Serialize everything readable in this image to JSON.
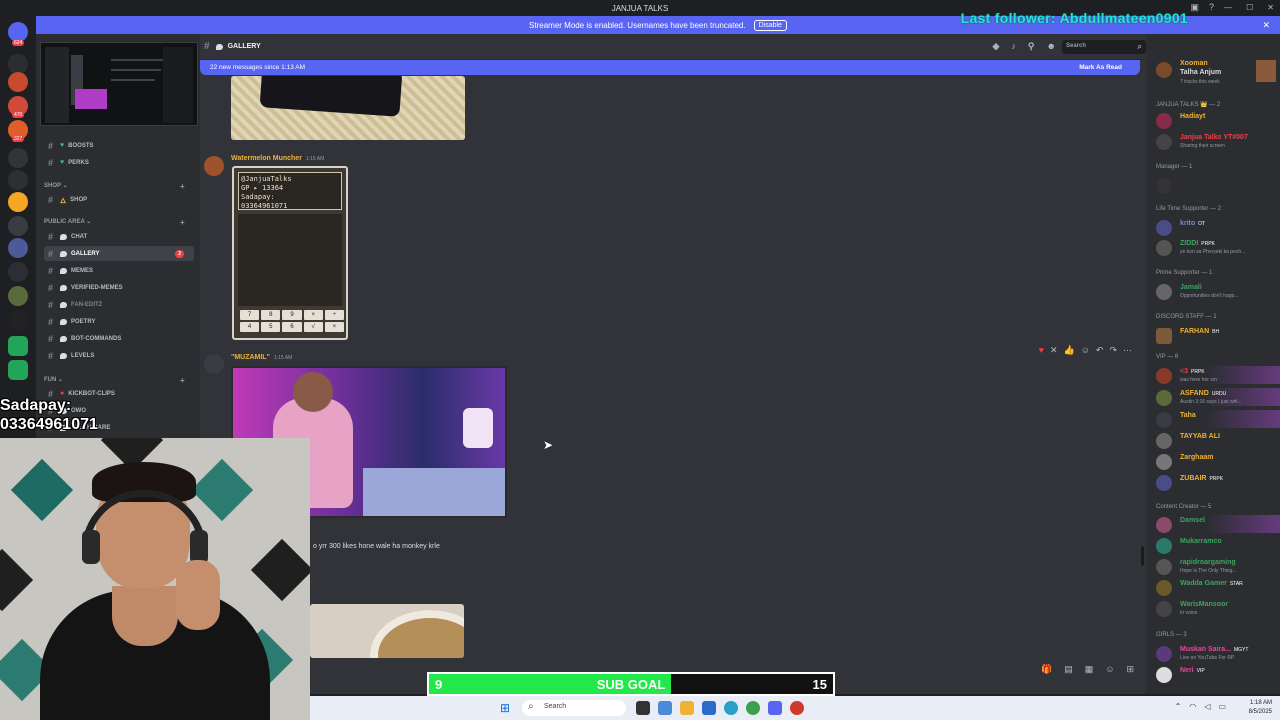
{
  "window": {
    "title": "JANJUA TALKS"
  },
  "overlays": {
    "last_follower": "Last follower: Abdullmateen0901",
    "sadapay_line1": "Sadapay:",
    "sadapay_line2": "03364961071"
  },
  "banner": {
    "text": "Streamer Mode is enabled. Usernames have been truncated.",
    "disable_label": "Disable"
  },
  "rail": {
    "badges": [
      "624",
      "470",
      "327"
    ]
  },
  "sidebar": {
    "categories": {
      "shop": "SHOP",
      "public": "PUBLIC AREA",
      "fun": "FUN"
    },
    "channels": [
      "BOOSTS",
      "PERKS",
      "SHOP",
      "CHAT",
      "GALLERY",
      "MEMES",
      "VERIFIED-MEMES",
      "FAN-EDITZ",
      "POETRY",
      "BOT-COMMANDS",
      "LEVELS",
      "KICKBOT-CLIPS",
      "OWO",
      "TRUTH-DARE"
    ],
    "gallery_badge": "2"
  },
  "header": {
    "channel": "GALLERY",
    "search_placeholder": "Search"
  },
  "new_messages": {
    "text": "22 new messages since 1:13 AM",
    "mark_read": "Mark As Read"
  },
  "messages": [
    {
      "author": "Watermelon Muncher",
      "time": "1:15 AM",
      "color": "#f0b232"
    },
    {
      "author": "\"MUZAMIL\"",
      "time": "1:15 AM",
      "color": "#f0b232"
    }
  ],
  "calc_screen": {
    "line1": "@JanjuaTalks",
    "line2": "GP ▸ 13364",
    "line3": "Sadapay:",
    "line4": "03364961071"
  },
  "calc_keys": [
    "7",
    "8",
    "9",
    "×",
    "÷",
    "4",
    "5",
    "6",
    "√",
    "×"
  ],
  "reply": {
    "text": "o yrr 300 likes hone wale ha monkey krle"
  },
  "members": {
    "top": {
      "name": "Xooman",
      "name2": "Talha Anjum",
      "status": "7 tracks this week"
    },
    "groups": [
      {
        "label": "JANJUA TALKS 👑 — 2"
      },
      {
        "label": "Manager — 1"
      },
      {
        "label": "Life Time Supporter — 2"
      },
      {
        "label": "Prime Supporter — 1"
      },
      {
        "label": "DISCORD STAFF — 1"
      },
      {
        "label": "VIP — 6"
      },
      {
        "label": "Content Creator — 5"
      },
      {
        "label": "GIRLS — 3"
      }
    ],
    "list": [
      {
        "name": "Hadiayt",
        "status": "",
        "tag": "",
        "color": "#f0b232"
      },
      {
        "name": "Janjua Talks YT#007",
        "status": "Sharing their screen",
        "tag": "",
        "color": "#f23f43"
      },
      {
        "name": "krito",
        "status": "",
        "tag": "OT",
        "color": "#5865f2"
      },
      {
        "name": "ZIDDI",
        "status": "ye kon sa Pheryeki ka pech...",
        "tag": "PRPK",
        "color": "#3ba55d"
      },
      {
        "name": "Jamali",
        "status": "Opportunities don't happ...",
        "tag": "",
        "color": "#3ba55d"
      },
      {
        "name": "FARHAN",
        "status": "",
        "tag": "BH",
        "color": "#f0b232"
      },
      {
        "name": "<3",
        "status": "was here her sm",
        "tag": "PRPK",
        "color": "#f23f43"
      },
      {
        "name": "ASFAND",
        "status": "Austin 3:16 says I just whi...",
        "tag": "URDU",
        "color": "#f0b232"
      },
      {
        "name": "Taha",
        "status": "",
        "tag": "",
        "color": "#f0b232"
      },
      {
        "name": "TAYYAB ALI",
        "status": "",
        "tag": "",
        "color": "#f0b232"
      },
      {
        "name": "Zarghaam",
        "status": "",
        "tag": "",
        "color": "#f0b232"
      },
      {
        "name": "ZUBAIR",
        "status": "",
        "tag": "PRPK",
        "color": "#f0b232"
      },
      {
        "name": "Damsel",
        "status": "",
        "tag": "",
        "color": "#3ba55d"
      },
      {
        "name": "Mukarramco",
        "status": "",
        "tag": "",
        "color": "#3ba55d"
      },
      {
        "name": "rapidroargaming",
        "status": "Hope is The Only Thing...",
        "tag": "",
        "color": "#3ba55d"
      },
      {
        "name": "Wadda Gamer",
        "status": "",
        "tag": "STAR",
        "color": "#3ba55d"
      },
      {
        "name": "WarisMansoor",
        "status": "In voice",
        "tag": "",
        "color": "#3ba55d"
      },
      {
        "name": "Muskan Saira...",
        "status": "Live on YouTube For RP",
        "tag": "MGYT",
        "color": "#eb459e"
      },
      {
        "name": "Neri",
        "status": "",
        "tag": "VIP",
        "color": "#eb459e"
      }
    ]
  },
  "sub_goal": {
    "current": 9,
    "label": "SUB GOAL",
    "target": 15,
    "fraction": 0.6
  },
  "taskbar": {
    "search": "Search",
    "time": "1:18 AM",
    "date": "8/5/2025"
  },
  "colors": {
    "blurple": "#5865f2",
    "goal_green": "#22e84a",
    "follower_cyan": "#22e6d0"
  }
}
